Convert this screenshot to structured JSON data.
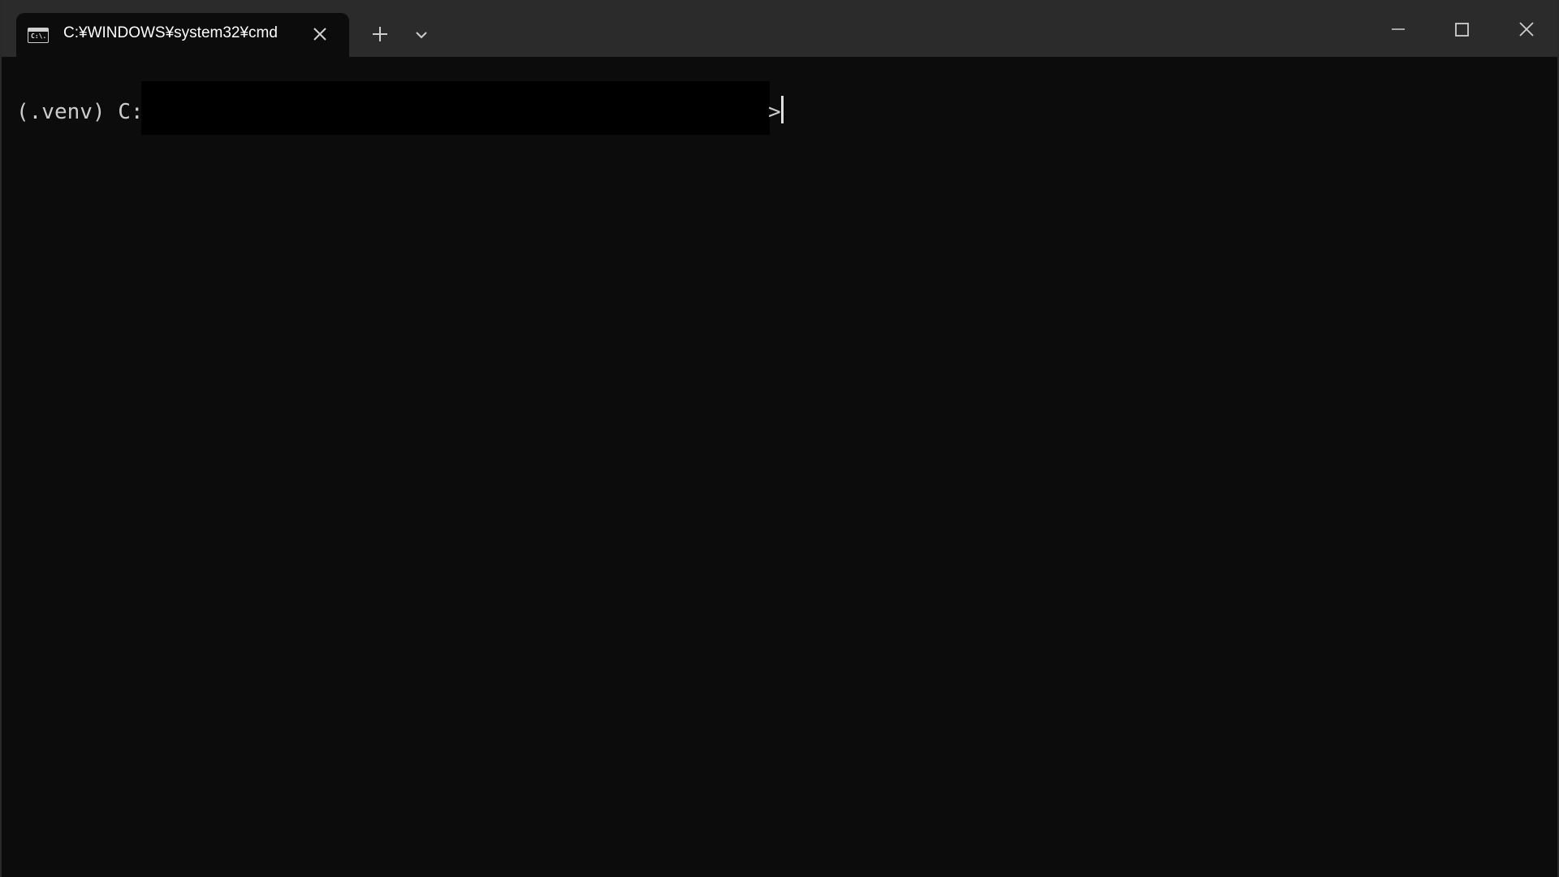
{
  "tab": {
    "icon_text": "C:\\.",
    "title": "C:¥WINDOWS¥system32¥cmd"
  },
  "terminal": {
    "prompt_prefix": "(.venv) C:",
    "prompt_end": ">"
  },
  "icons": {
    "tab_icon": "cmd-icon",
    "tab_close": "close-icon",
    "new_tab": "plus-icon",
    "dropdown": "chevron-down-icon",
    "minimize": "minimize-icon",
    "maximize": "maximize-icon",
    "close": "close-icon"
  },
  "colors": {
    "titlebar": "#2b2b2b",
    "terminal_bg": "#0c0c0c",
    "text": "#cccccc",
    "redaction": "#000000"
  }
}
